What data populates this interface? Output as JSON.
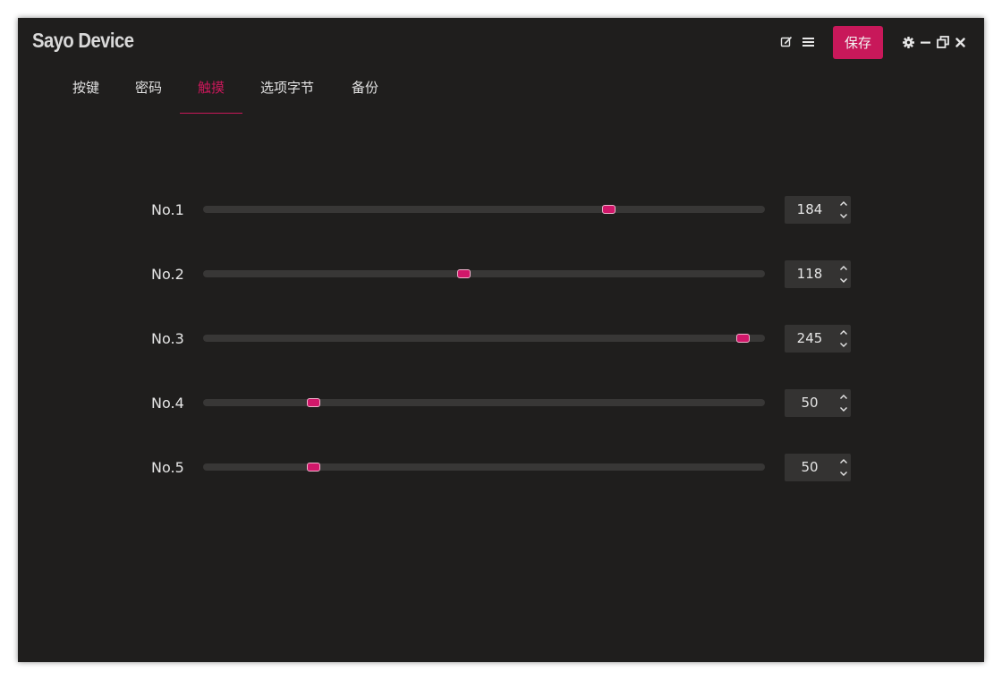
{
  "app": {
    "title": "Sayo Device"
  },
  "toolbar": {
    "save_label": "保存",
    "icons": [
      "edit-icon",
      "menu-icon",
      "gear-icon",
      "minimize-icon",
      "restore-icon",
      "close-icon"
    ]
  },
  "tabs": [
    {
      "label": "按键",
      "active": false
    },
    {
      "label": "密码",
      "active": false
    },
    {
      "label": "触摸",
      "active": true
    },
    {
      "label": "选项字节",
      "active": false
    },
    {
      "label": "备份",
      "active": false
    }
  ],
  "sliders": {
    "max": 255,
    "items": [
      {
        "label": "No.1",
        "value": "184"
      },
      {
        "label": "No.2",
        "value": "118"
      },
      {
        "label": "No.3",
        "value": "245"
      },
      {
        "label": "No.4",
        "value": "50"
      },
      {
        "label": "No.5",
        "value": "50"
      }
    ]
  },
  "colors": {
    "accent": "#c8185a",
    "background": "#1f1e1d",
    "track": "#383736",
    "spinbox": "#343332"
  }
}
